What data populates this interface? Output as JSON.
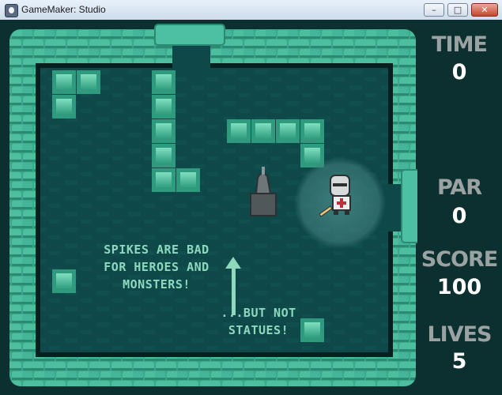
{
  "window": {
    "title": "GameMaker: Studio",
    "minimize": "–",
    "maximize": "□",
    "close": "✕"
  },
  "hud": {
    "time_label": "TIME",
    "time_value": "0",
    "par_label": "PAR",
    "par_value": "0",
    "score_label": "SCORE",
    "score_value": "100",
    "lives_label": "LIVES",
    "lives_value": "5"
  },
  "hints": {
    "spikes_line1": "SPIKES ARE BAD",
    "spikes_line2": "FOR HEROES AND",
    "spikes_line3": "MONSTERS!",
    "statues_line1": "...BUT NOT",
    "statues_line2": "STATUES!"
  },
  "colors": {
    "wall": "#3fae92",
    "floor": "#0f4848",
    "spike_block": "#3fae92",
    "hud_label": "#9aa2a2",
    "hint_text": "#8ed9bd"
  }
}
